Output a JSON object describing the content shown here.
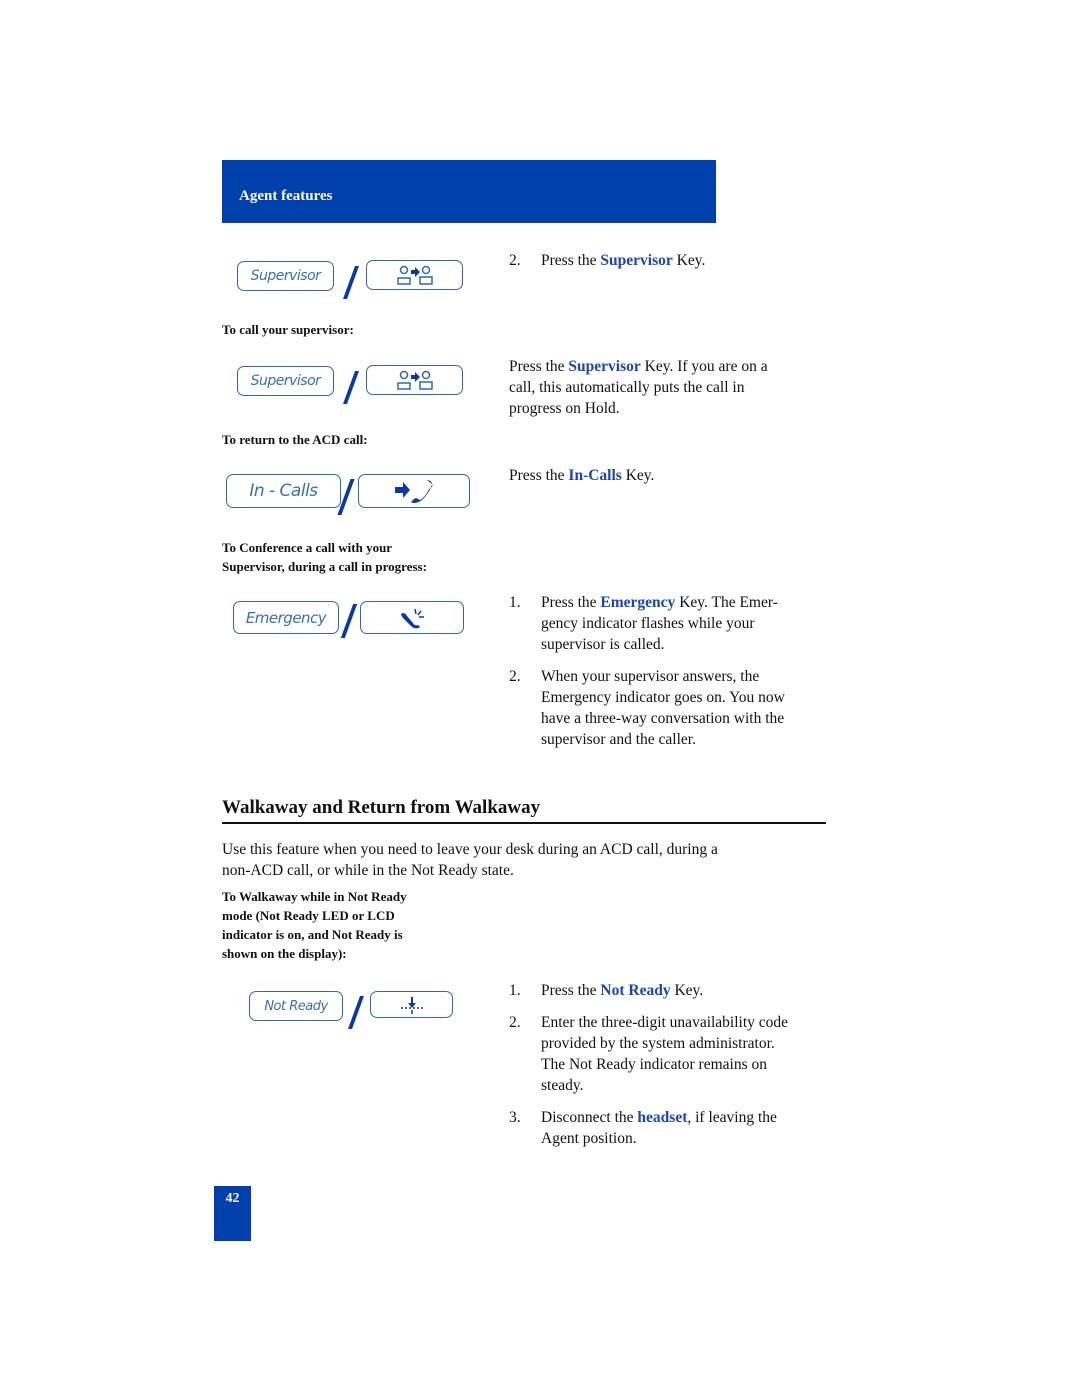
{
  "header": {
    "section_title": "Agent features"
  },
  "keys": {
    "supervisor": "Supervisor",
    "in_calls": "In - Calls",
    "emergency": "Emergency",
    "not_ready": "Not Ready"
  },
  "captions": {
    "call_supervisor": "To call your supervisor:",
    "return_acd": "To return to the ACD call:",
    "conference_line1": "To Conference a call with your",
    "conference_line2": "Supervisor, during a call in progress:",
    "walkaway_line1": "To Walkaway while in Not Ready",
    "walkaway_line2": "mode (Not Ready LED or LCD",
    "walkaway_line3": "indicator is on, and Not Ready is",
    "walkaway_line4": "shown on the display):"
  },
  "instructions": {
    "step_press_supervisor": {
      "num": "2.",
      "pre": "Press the ",
      "key": "Supervisor",
      "post": " Key."
    },
    "call_supervisor": {
      "pre": "Press the ",
      "key": "Supervisor",
      "post1": " Key. If you are on a",
      "line2": "call, this automatically puts the call in",
      "line3": "progress on Hold."
    },
    "return_acd": {
      "pre": "Press the ",
      "key": "In-Calls",
      "post": " Key."
    },
    "conference": [
      {
        "num": "1.",
        "pre": "Press the ",
        "key": "Emergency",
        "post": " Key. The Emer-",
        "line2": "gency indicator flashes while your",
        "line3": "supervisor is called."
      },
      {
        "num": "2.",
        "line1": "When your supervisor answers, the",
        "line2": "Emergency indicator goes on. You now",
        "line3": "have a three-way conversation with the",
        "line4": "supervisor and the caller."
      }
    ]
  },
  "walkaway": {
    "heading": "Walkaway and Return from Walkaway",
    "intro_line1": "Use this feature when you need to leave your desk during an ACD call, during a",
    "intro_line2": "non-ACD call, or while in the Not Ready state.",
    "steps": [
      {
        "num": "1.",
        "pre": "Press the ",
        "key": "Not Ready",
        "post": " Key."
      },
      {
        "num": "2.",
        "line1": "Enter the three-digit unavailability code",
        "line2": "provided by the system administrator.",
        "line3": "The Not Ready indicator remains on",
        "line4": "steady."
      },
      {
        "num": "3.",
        "pre": "Disconnect the ",
        "key": "headset",
        "post": ", if leaving the",
        "line2": "Agent position."
      }
    ]
  },
  "footer": {
    "page_number": "42"
  },
  "colors": {
    "brand_blue": "#0040ad",
    "highlight_blue": "#1d45b0",
    "key_outline": "#2f6aa6"
  }
}
